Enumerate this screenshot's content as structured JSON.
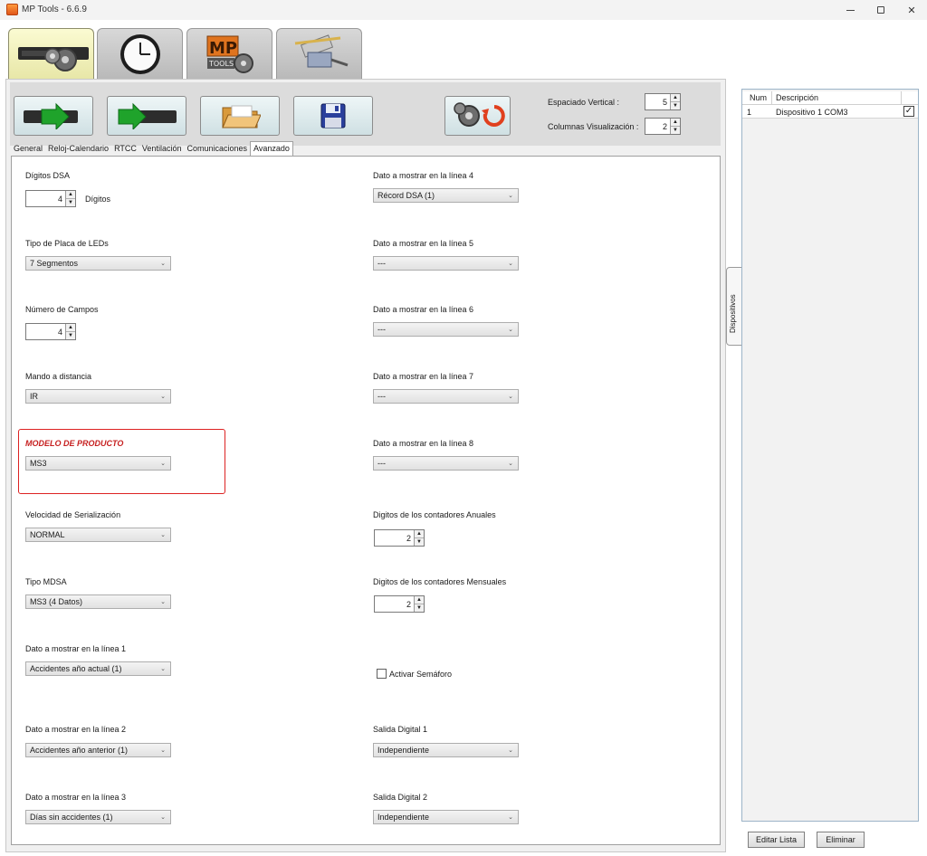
{
  "window": {
    "title": "MP Tools - 6.6.9"
  },
  "toolbar": {
    "vertical_spacing_label": "Espaciado Vertical :",
    "vertical_spacing_value": "5",
    "columns_label": "Columnas Visualización :",
    "columns_value": "2"
  },
  "inner_tabs": [
    "General",
    "Reloj-Calendario",
    "RTCC",
    "Ventilación",
    "Comunicaciones",
    "Avanzado"
  ],
  "form": {
    "digitos_dsa": {
      "label": "Dígitos DSA",
      "value": "4",
      "suffix": "Dígitos"
    },
    "tipo_placa": {
      "label": "Tipo de Placa de LEDs",
      "value": "7 Segmentos"
    },
    "num_campos": {
      "label": "Número de Campos",
      "value": "4"
    },
    "mando": {
      "label": "Mando a distancia",
      "value": "IR"
    },
    "modelo": {
      "label": "MODELO DE PRODUCTO",
      "value": "MS3"
    },
    "velocidad": {
      "label": "Velocidad de Serialización",
      "value": "NORMAL"
    },
    "tipo_mdsa": {
      "label": "Tipo MDSA",
      "value": "MS3 (4 Datos)"
    },
    "linea1": {
      "label": "Dato a mostrar en la línea 1",
      "value": "Accidentes año actual (1)"
    },
    "linea2": {
      "label": "Dato a mostrar en la línea 2",
      "value": "Accidentes año anterior (1)"
    },
    "linea3": {
      "label": "Dato a mostrar en la línea 3",
      "value": "Días sin accidentes (1)"
    },
    "linea4": {
      "label": "Dato a mostrar en la línea 4",
      "value": "Récord DSA (1)"
    },
    "linea5": {
      "label": "Dato a mostrar en la línea 5",
      "value": "---"
    },
    "linea6": {
      "label": "Dato a mostrar en la línea 6",
      "value": "---"
    },
    "linea7": {
      "label": "Dato a mostrar en la línea 7",
      "value": "---"
    },
    "linea8": {
      "label": "Dato a mostrar en la línea 8",
      "value": "---"
    },
    "anuales": {
      "label": "Digitos de los contadores Anuales",
      "value": "2"
    },
    "mensuales": {
      "label": "Digitos de los contadores Mensuales",
      "value": "2"
    },
    "semaforo": {
      "label": "Activar Semáforo",
      "checked": false
    },
    "salida1": {
      "label": "Salida Digital 1",
      "value": "Independiente"
    },
    "salida2": {
      "label": "Salida Digital 2",
      "value": "Independiente"
    }
  },
  "devices": {
    "side_tab": "Dispositivos",
    "headers": {
      "num": "Num",
      "desc": "Descripción"
    },
    "rows": [
      {
        "num": "1",
        "desc": "Dispositivo 1 COM3",
        "checked": true
      }
    ],
    "edit_button": "Editar Lista",
    "delete_button": "Eliminar"
  }
}
